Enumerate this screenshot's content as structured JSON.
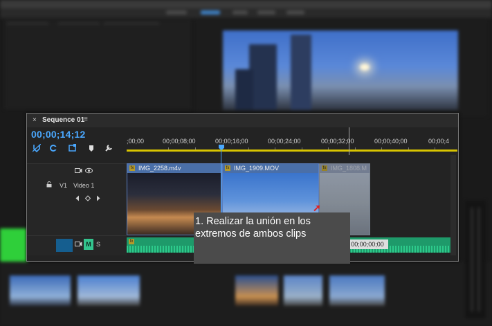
{
  "sequence": {
    "title": "Sequence 01",
    "close_glyph": "×",
    "menu_glyph": "≡",
    "timecode": "00;00;14;12"
  },
  "ruler": {
    "labels": [
      ";00;00",
      "00;00;08;00",
      "00;00;16;00",
      "00;00;24;00",
      "00;00;32;00",
      "00;00;40;00",
      "00;00;4"
    ]
  },
  "tracks": {
    "video": {
      "id": "V1",
      "name": "Video 1"
    },
    "audio": {
      "mute": "M",
      "solo": "S"
    }
  },
  "clips": [
    {
      "name": "IMG_2258.m4v"
    },
    {
      "name": "IMG_1909.MOV"
    },
    {
      "name": "IMG_1808.M"
    }
  ],
  "timecode_overlay": "00;00;00;00",
  "caption": {
    "line1": "1. Realizar la unión en los",
    "line2": "extremos de ambos clips"
  },
  "colors": {
    "accent": "#4aa8ff",
    "clip_blue": "#4a6fa8",
    "audio_green": "#1e9a6a",
    "work_area": "#d8c400",
    "arrow": "#e02020"
  },
  "icons": [
    "snap-icon",
    "linked-selection-icon",
    "add-marker-icon",
    "marker-icon",
    "wrench-icon",
    "lock-icon",
    "camera-icon",
    "eye-icon",
    "keyframe-nav-icon"
  ]
}
